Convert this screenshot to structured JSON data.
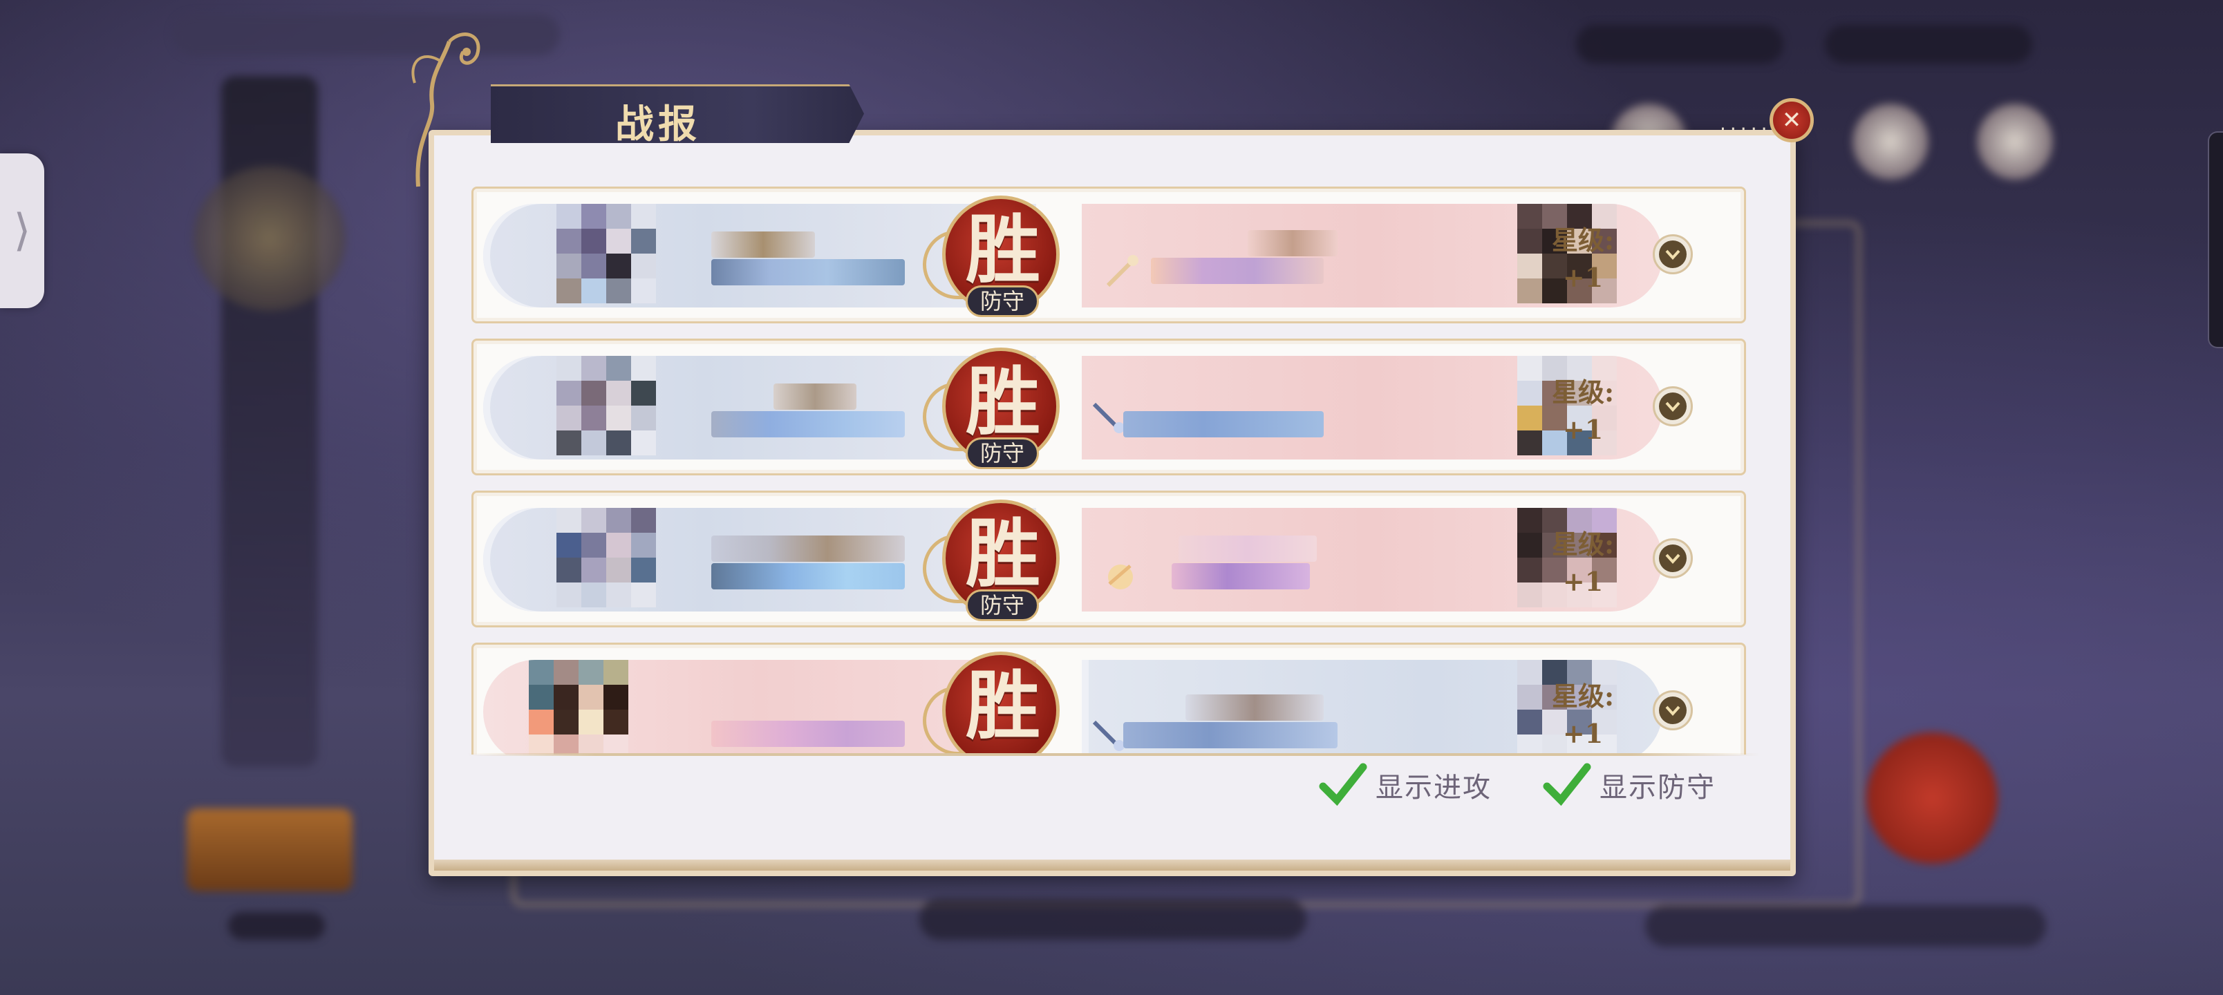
{
  "dialog": {
    "title": "战报",
    "close_label": "✕",
    "menu_dots": "·····"
  },
  "side_tab": {
    "glyph": "⟩"
  },
  "reports": [
    {
      "result": "胜",
      "role": "防守",
      "star_label": "星级:",
      "star_value": "+1",
      "left_side": "blue",
      "right_side": "pink"
    },
    {
      "result": "胜",
      "role": "防守",
      "star_label": "星级:",
      "star_value": "+1",
      "left_side": "blue",
      "right_side": "pink"
    },
    {
      "result": "胜",
      "role": "防守",
      "star_label": "星级:",
      "star_value": "+1",
      "left_side": "blue",
      "right_side": "pink"
    },
    {
      "result": "胜",
      "role": "",
      "star_label": "星级:",
      "star_value": "+1",
      "left_side": "pink",
      "right_side": "blue"
    }
  ],
  "filters": {
    "show_attack": {
      "label": "显示进攻",
      "checked": true
    },
    "show_defense": {
      "label": "显示防守",
      "checked": true
    }
  },
  "colors": {
    "accent_gold": "#d8b577",
    "victory_red": "#b3291f",
    "check_green": "#3fae3a",
    "title_bar": "#2d2b45"
  },
  "icons": {
    "close": "close-icon",
    "expand": "chevron-down-icon",
    "check": "check-icon",
    "side": "chevron-right-icon",
    "weapon": "weapon-icon"
  }
}
